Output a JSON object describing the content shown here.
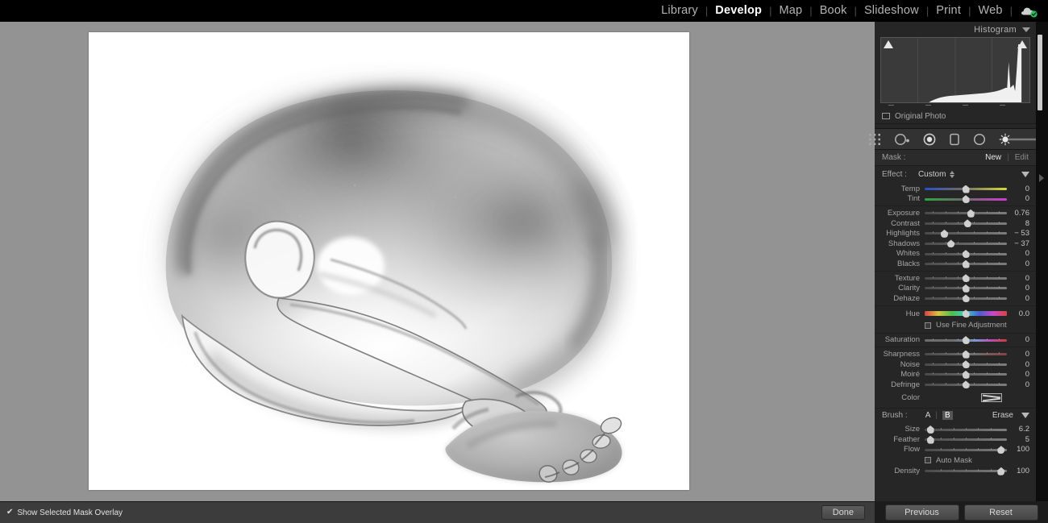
{
  "module_bar": {
    "items": [
      {
        "label": "Library",
        "active": false
      },
      {
        "label": "Develop",
        "active": true
      },
      {
        "label": "Map",
        "active": false
      },
      {
        "label": "Book",
        "active": false
      },
      {
        "label": "Slideshow",
        "active": false
      },
      {
        "label": "Print",
        "active": false
      },
      {
        "label": "Web",
        "active": false
      }
    ],
    "separator": "|",
    "cloud_icon": "cloud-sync-check-icon",
    "accent_color": "#2fbf5f"
  },
  "histogram": {
    "title": "Histogram",
    "original_photo_label": "Original Photo",
    "collapse_icon": "chevron-down-icon",
    "clip_left_icon": "shadow-clipping-triangle",
    "clip_right_icon": "highlight-clipping-triangle"
  },
  "tools": [
    {
      "name": "crop-overlay-tool",
      "selected": false
    },
    {
      "name": "spot-removal-tool",
      "selected": false
    },
    {
      "name": "red-eye-tool",
      "selected": false
    },
    {
      "name": "graduated-filter-tool",
      "selected": false
    },
    {
      "name": "radial-filter-tool",
      "selected": false
    },
    {
      "name": "adjustment-brush-tool",
      "selected": true
    }
  ],
  "mask": {
    "label": "Mask :",
    "new_label": "New",
    "separator": "|",
    "edit_label": "Edit"
  },
  "effect": {
    "label": "Effect :",
    "value": "Custom",
    "collapse_icon": "chevron-down-icon"
  },
  "sliders": {
    "group_white_balance": [
      {
        "name": "Temp",
        "value": "0",
        "pos": 50,
        "grad": "grad-temp"
      },
      {
        "name": "Tint",
        "value": "0",
        "pos": 50,
        "grad": "grad-tint"
      }
    ],
    "group_tone": [
      {
        "name": "Exposure",
        "value": "0.76",
        "pos": 56,
        "grad": ""
      },
      {
        "name": "Contrast",
        "value": "8",
        "pos": 52,
        "grad": ""
      },
      {
        "name": "Highlights",
        "value": "− 53",
        "pos": 24,
        "grad": ""
      },
      {
        "name": "Shadows",
        "value": "− 37",
        "pos": 32,
        "grad": ""
      },
      {
        "name": "Whites",
        "value": "0",
        "pos": 50,
        "grad": ""
      },
      {
        "name": "Blacks",
        "value": "0",
        "pos": 50,
        "grad": ""
      }
    ],
    "group_presence": [
      {
        "name": "Texture",
        "value": "0",
        "pos": 50,
        "grad": ""
      },
      {
        "name": "Clarity",
        "value": "0",
        "pos": 50,
        "grad": ""
      },
      {
        "name": "Dehaze",
        "value": "0",
        "pos": 50,
        "grad": ""
      }
    ],
    "group_hue": [
      {
        "name": "Hue",
        "value": "0.0",
        "pos": 50,
        "grad": "grad-hue"
      }
    ],
    "group_saturation": [
      {
        "name": "Saturation",
        "value": "0",
        "pos": 50,
        "grad": "grad-sat"
      }
    ],
    "group_detail": [
      {
        "name": "Sharpness",
        "value": "0",
        "pos": 50,
        "grad": "grad-sharp"
      },
      {
        "name": "Noise",
        "value": "0",
        "pos": 50,
        "grad": ""
      },
      {
        "name": "Moiré",
        "value": "0",
        "pos": 50,
        "grad": ""
      },
      {
        "name": "Defringe",
        "value": "0",
        "pos": 50,
        "grad": ""
      }
    ],
    "group_brush": [
      {
        "name": "Size",
        "value": "6.2",
        "pos": 7,
        "grad": ""
      },
      {
        "name": "Feather",
        "value": "5",
        "pos": 7,
        "grad": ""
      },
      {
        "name": "Flow",
        "value": "100",
        "pos": 93,
        "grad": ""
      }
    ],
    "group_density": [
      {
        "name": "Density",
        "value": "100",
        "pos": 93,
        "grad": ""
      }
    ]
  },
  "fine_adjustment": {
    "label": "Use Fine Adjustment",
    "checked": false
  },
  "auto_mask": {
    "label": "Auto Mask",
    "checked": false
  },
  "color": {
    "label": "Color",
    "swatch_name": "color-swatch-none"
  },
  "brush": {
    "label": "Brush :",
    "a_label": "A",
    "separator": "|",
    "b_label": "B",
    "erase_label": "Erase",
    "selected": "B",
    "collapse_icon": "chevron-down-icon"
  },
  "bottom_toolbar": {
    "mask_overlay_label": "Show Selected Mask Overlay",
    "mask_overlay_checked": true,
    "check_glyph": "✔",
    "done_label": "Done"
  },
  "bottom_right": {
    "previous_label": "Previous",
    "reset_label": "Reset"
  },
  "photo": {
    "alt": "high-key black and white photograph of a curled nude figure",
    "background": "#ffffff",
    "canvas_background": "#939393"
  }
}
